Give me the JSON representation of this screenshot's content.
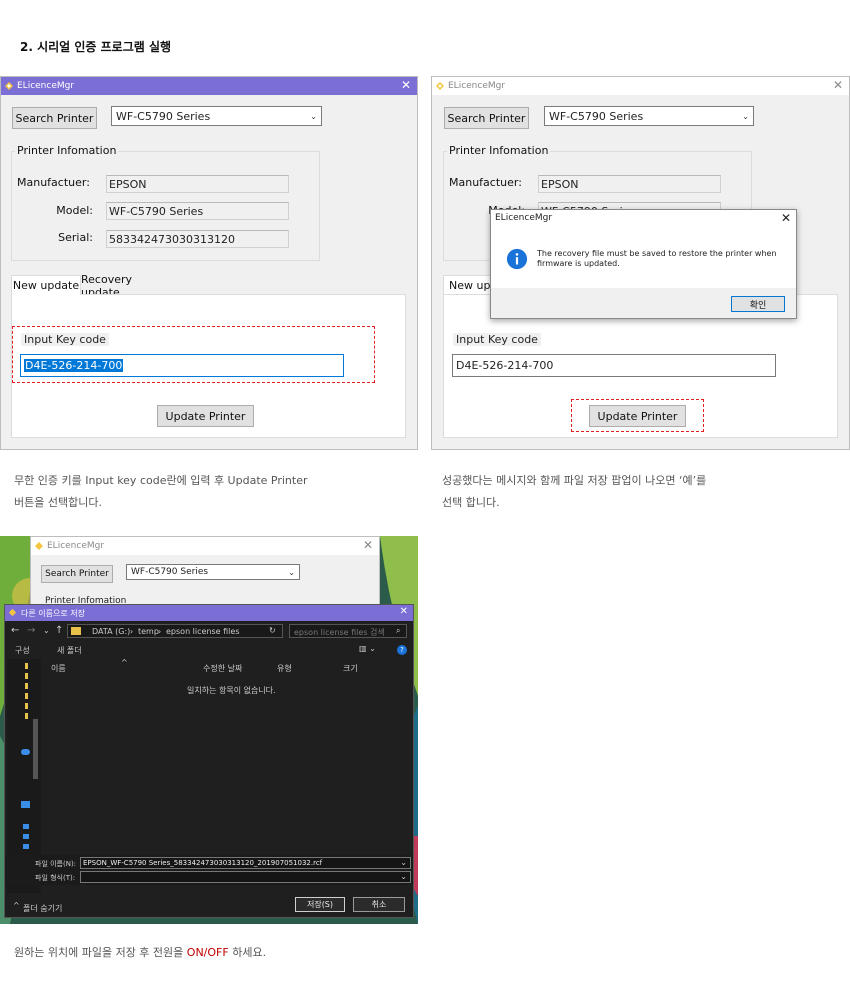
{
  "heading": "2. 시리얼 인증 프로그램 실행",
  "app_window": {
    "title": "ELicenceMgr",
    "search_button": "Search Printer",
    "printer_model_select": "WF-C5790 Series",
    "group_label": "Printer Infomation",
    "manufacturer_label": "Manufactuer:",
    "manufacturer_value": "EPSON",
    "model_label": "Model:",
    "model_value": "WF-C5790 Series",
    "serial_label": "Serial:",
    "serial_value": "583342473030313120",
    "tab_new": "New update",
    "tab_recovery": "Recovery update",
    "input_label": "Input Key code",
    "key_code": "D4E-526-214-700",
    "update_button": "Update Printer"
  },
  "message_dialog": {
    "title": "ELicenceMgr",
    "message": "The recovery file must be saved to restore the printer when firmware is updated.",
    "ok_button": "확인",
    "model_partial": "WF-C5790 Series",
    "model_label_partial": "Model:",
    "tab_partial": "New upd"
  },
  "captions": {
    "left_line1": "무한 인증 키를 Input key code란에 입력 후 Update Printer",
    "left_line2": "버튼을 선택합니다.",
    "right_line1": "성공했다는 메시지와 함께 파일 저장 팝업이 나오면 ‘예’를",
    "right_line2": "선택 합니다.",
    "bottom_prefix": "원하는 위치에 파일을 저장 후 전원을",
    "bottom_highlight": "ON/OFF",
    "bottom_suffix": "하세요."
  },
  "save_dialog": {
    "title": "다른 이름으로 저장",
    "breadcrumb": [
      "DATA (G:)",
      "temp",
      "epson license files"
    ],
    "search_placeholder": "epson license files 검색",
    "organize": "구성",
    "new_folder": "새 폴더",
    "col_name": "이름",
    "col_modified": "수정한 날짜",
    "col_type": "유형",
    "col_size": "크기",
    "empty_message": "일치하는 항목이 없습니다.",
    "filename_label": "파일 이름(N):",
    "filename_value": "EPSON_WF-C5790 Series_583342473030313120_201907051032.rcf",
    "filetype_label": "파일 형식(T):",
    "filetype_value": "",
    "hide_folders": "폴더 숨기기",
    "save_button": "저장(S)",
    "cancel_button": "취소"
  },
  "colors": {
    "titlebar_active": "#7b6fd6",
    "dashed_highlight": "#e02020",
    "on_off": "#c00000",
    "info_icon": "#1a73d9"
  }
}
